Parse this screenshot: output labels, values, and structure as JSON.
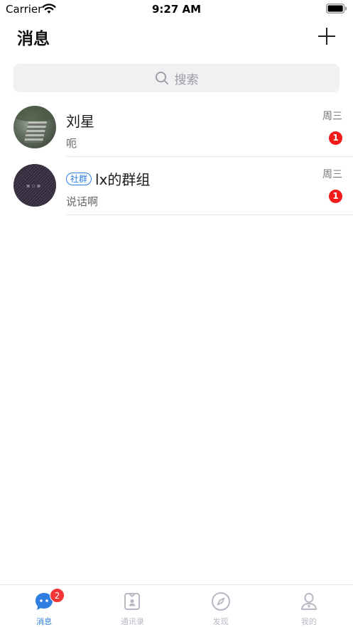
{
  "status_bar": {
    "carrier": "Carrier",
    "time": "9:27 AM"
  },
  "nav": {
    "title": "消息",
    "add_icon": "plus-icon"
  },
  "search": {
    "placeholder": "搜索",
    "icon": "search-icon"
  },
  "conversations": [
    {
      "name": "刘星",
      "tag": "",
      "preview": "呃",
      "time": "周三",
      "unread": "1"
    },
    {
      "name": "lx的群组",
      "tag": "社群",
      "preview": "说话啊",
      "time": "周三",
      "unread": "1"
    }
  ],
  "tabbar": {
    "tabs": [
      {
        "label": "消息",
        "icon": "chat-bubble-icon",
        "badge": "2"
      },
      {
        "label": "通讯录",
        "icon": "contacts-icon"
      },
      {
        "label": "发现",
        "icon": "compass-icon"
      },
      {
        "label": "我的",
        "icon": "person-icon"
      }
    ]
  },
  "colors": {
    "accent": "#2f7de1",
    "badge": "#f21b1b",
    "tab_inactive": "#b8b8c4"
  }
}
